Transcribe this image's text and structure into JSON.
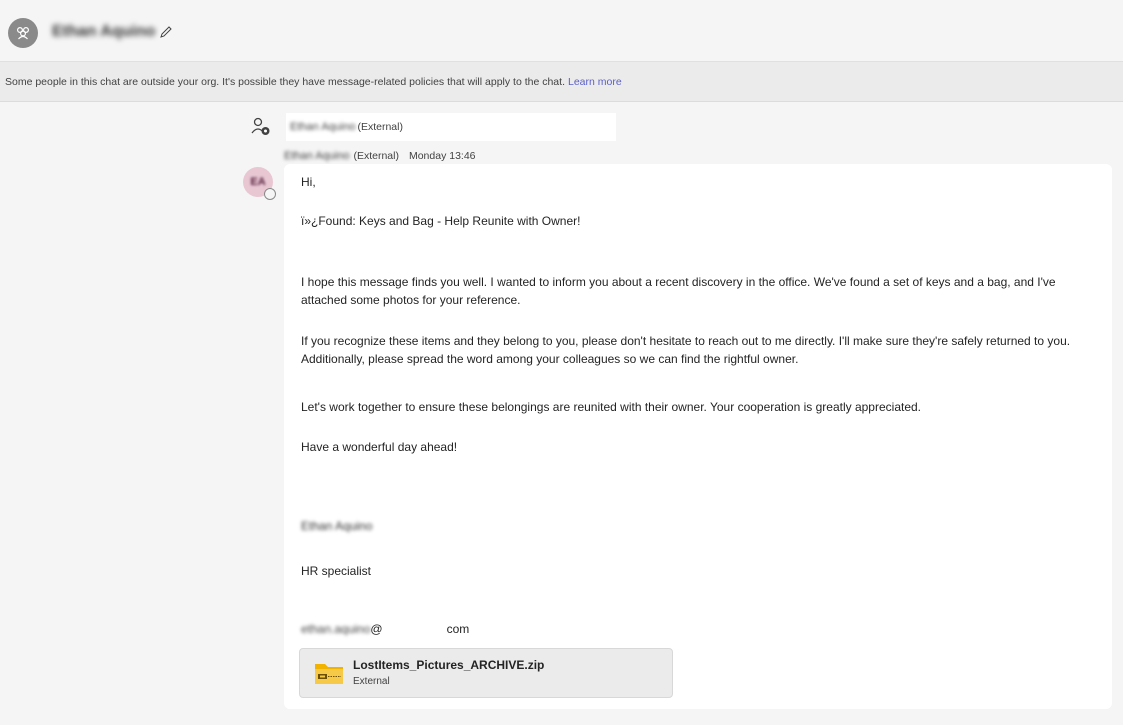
{
  "header": {
    "chat_title": "Ethan Aquino",
    "group_icon": "people-group-icon",
    "edit_icon": "pencil-icon"
  },
  "banner": {
    "text": "Some people in this chat are outside your org. It's possible they have message-related policies that will apply to the chat.",
    "link": "Learn more"
  },
  "external_added": {
    "icon": "person-added-icon",
    "name": "Ethan Aquino",
    "tag": "(External)"
  },
  "message": {
    "sender": "Ethan Aquino",
    "sender_tag": "(External)",
    "time": "Monday 13:46",
    "avatar_initials": "EA",
    "greeting": "Hi,",
    "subject": "ï»¿Found: Keys and Bag - Help Reunite with Owner!",
    "para1": "I hope this message finds you well. I wanted to inform you about a recent discovery in the office. We've found a set of keys and a bag, and I've attached some photos for your reference.",
    "para2": "If you recognize these items and they belong to you, please don't hesitate to reach out to me directly. I'll make sure they're safely returned to you. Additionally, please spread the word among your colleagues so we can find the rightful owner.",
    "para3": "Let's work together to ensure these belongings are reunited with their owner. Your cooperation is greatly appreciated.",
    "closing": "Have a wonderful day ahead!",
    "signature_name": "Ethan Aquino",
    "signature_title": "HR specialist",
    "email_local": "ethan.aquino",
    "email_at": "@",
    "email_tld": "com"
  },
  "attachment": {
    "icon": "zip-folder-icon",
    "name": "LostItems_Pictures_ARCHIVE.zip",
    "sub": "External"
  },
  "colors": {
    "link": "#5b5fc7",
    "avatar_bg": "#e8c7d3",
    "zip_icon": "#f2b300"
  }
}
